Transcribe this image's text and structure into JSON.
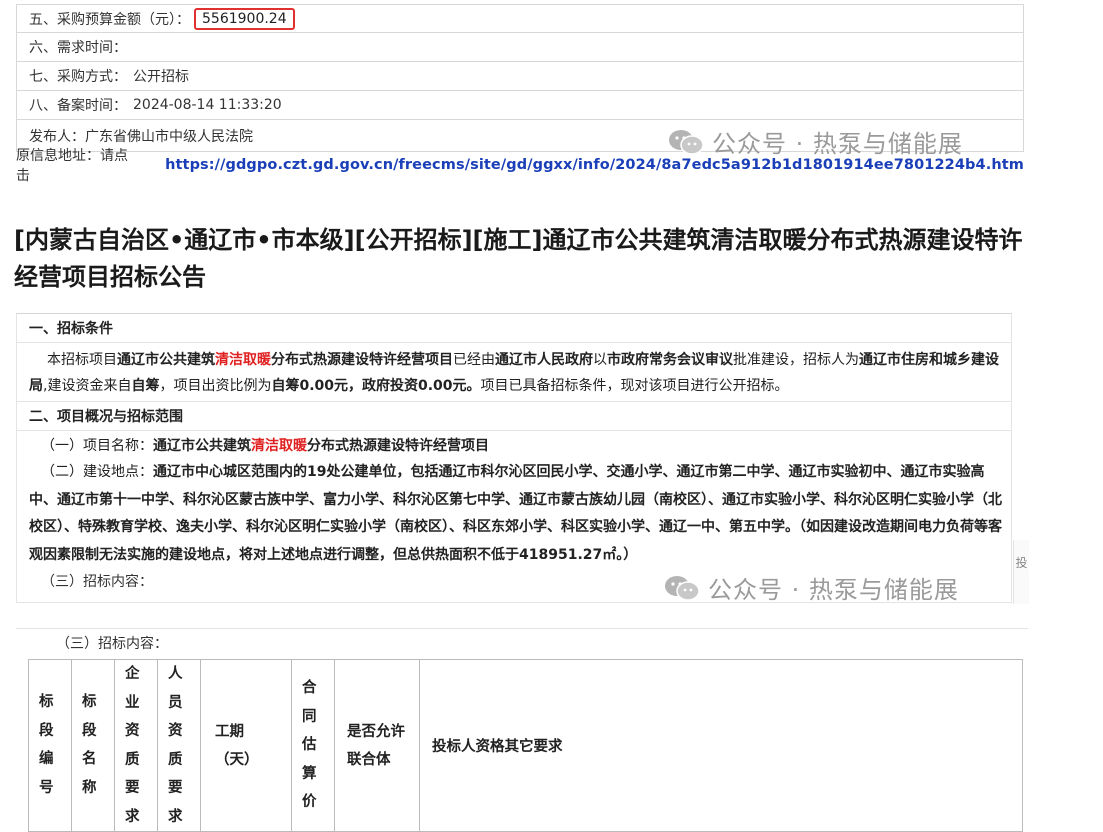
{
  "top_info": {
    "budget_label": "五、采购预算金额（元）：",
    "budget_value": "5561900.24",
    "demand_time_label": "六、需求时间：",
    "method_label": "七、采购方式：",
    "method_value": "公开招标",
    "record_time_label": "八、备案时间：",
    "record_time_value": "2024-08-14 11:33:20",
    "publisher_label": "发布人：",
    "publisher_value": "广东省佛山市中级人民法院",
    "source_label": "原信息地址：请点击",
    "source_url": "https://gdgpo.czt.gd.gov.cn/freecms/site/gd/ggxx/info/2024/8a7edc5a912b1d1801914ee7801224b4.htm"
  },
  "watermark": {
    "text": "公众号 · 热泵与储能展",
    "icon": "wechat-icon"
  },
  "heading": "[内蒙古自治区•通辽市•市本级][公开招标][施工]通辽市公共建筑清洁取暖分布式热源建设特许经营项目招标公告",
  "notice": {
    "section1_title": "一、招标条件",
    "s1_a": "本招标项目",
    "s1_b": "通辽市公共建筑",
    "s1_red": "清洁取暖",
    "s1_c": "分布式热源建设特许经营项目",
    "s1_d": "已经由",
    "s1_e": "通辽市人民政府",
    "s1_f": "以",
    "s1_g": "市政府常务会议审议",
    "s1_h": "批准建设，招标人为",
    "s1_i": "通辽市住房和城乡建设局",
    "s1_j": ",建设资金来自",
    "s1_k": "自筹",
    "s1_l": "，项目出资比例为",
    "s1_m": "自筹0.00元，政府投资0.00元。",
    "s1_n": "项目已具备招标条件，现对该项目进行公开招标。",
    "section2_title": "二、项目概况与招标范围",
    "item1_label": "（一）项目名称：",
    "item1_a": "通辽市公共建筑",
    "item1_red": "清洁取暖",
    "item1_b": "分布式热源建设特许经营项目",
    "item2_label": "（二）建设地点：",
    "item2_text": "通辽市中心城区范围内的19处公建单位，包括通辽市科尔沁区回民小学、交通小学、通辽市第二中学、通辽市实验初中、通辽市实验高中、通辽市第十一中学、科尔沁区蒙古族中学、富力小学、科尔沁区第七中学、通辽市蒙古族幼儿园（南校区）、通辽市实验小学、科尔沁区明仁实验小学（北校区）、特殊教育学校、逸夫小学、科尔沁区明仁实验小学（南校区）、科区东郊小学、科区实验小学、通辽一中、第五中学。（如因建设改造期间电力负荷等客观因素限制无法实施的建设地点，将对上述地点进行调整，但总供热面积不低于418951.27㎡。）",
    "item3_label": "（三）招标内容：",
    "side_char": "投"
  },
  "bid_table": {
    "caption": "（三）招标内容：",
    "col1": [
      "标",
      "段",
      "编",
      "号"
    ],
    "col2": [
      "标",
      "段",
      "名",
      "称"
    ],
    "col3": [
      "企",
      "业",
      "资",
      "质",
      "要",
      "求"
    ],
    "col4": [
      "人",
      "员",
      "资",
      "质",
      "要",
      "求"
    ],
    "col5": "工期（天）",
    "col6": [
      "合",
      "同",
      "估",
      "算",
      "价"
    ],
    "col7": "是否允许联合体",
    "col8": "投标人资格其它要求"
  }
}
